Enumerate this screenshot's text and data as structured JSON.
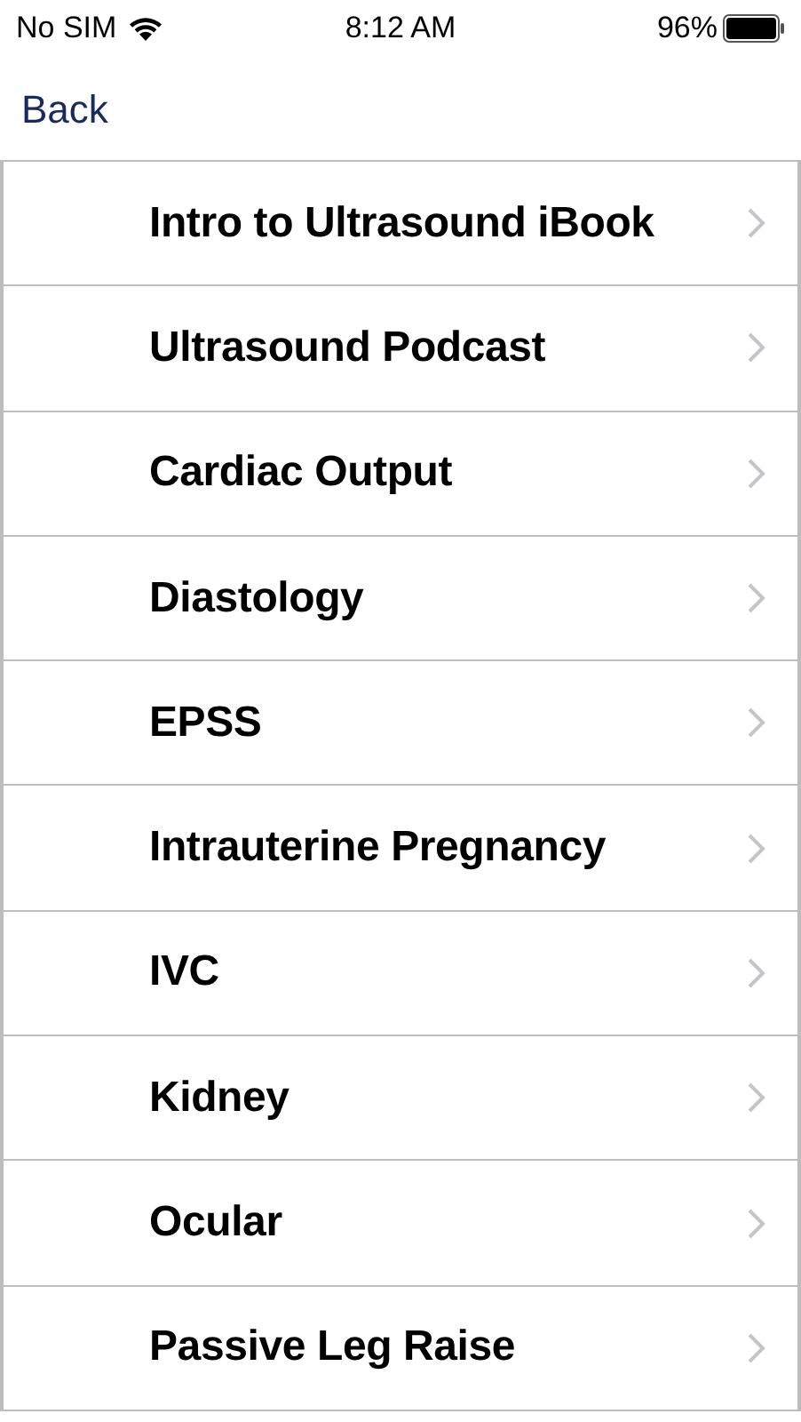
{
  "status_bar": {
    "carrier": "No SIM",
    "time": "8:12 AM",
    "battery": "96%"
  },
  "nav": {
    "back": "Back"
  },
  "items": [
    {
      "label": "Intro to Ultrasound iBook"
    },
    {
      "label": "Ultrasound Podcast"
    },
    {
      "label": "Cardiac Output"
    },
    {
      "label": "Diastology"
    },
    {
      "label": "EPSS"
    },
    {
      "label": "Intrauterine Pregnancy"
    },
    {
      "label": "IVC"
    },
    {
      "label": "Kidney"
    },
    {
      "label": "Ocular"
    },
    {
      "label": "Passive Leg Raise"
    }
  ]
}
